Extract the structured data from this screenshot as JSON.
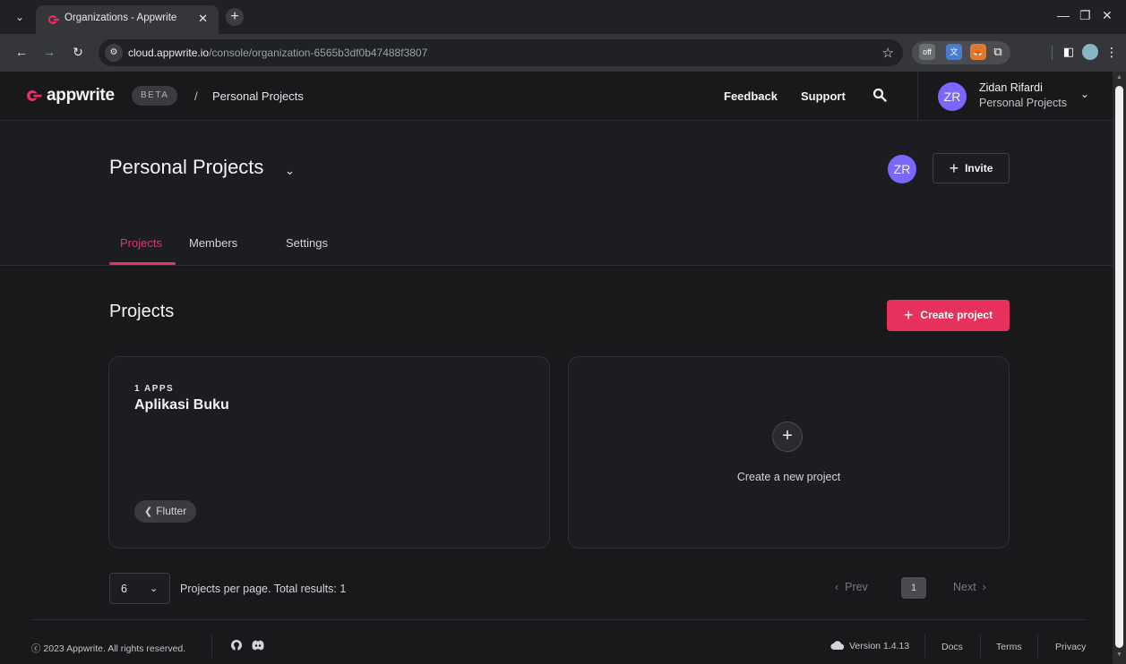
{
  "browser": {
    "tab_title": "Organizations - Appwrite",
    "url_host": "cloud.appwrite.io",
    "url_path": "/console/organization-6565b3df0b47488f3807"
  },
  "header": {
    "logo_text": "appwrite",
    "beta_label": "BETA",
    "breadcrumb_sep": "/",
    "breadcrumb": "Personal Projects",
    "feedback_label": "Feedback",
    "support_label": "Support",
    "user_initials": "ZR",
    "user_name": "Zidan Rifardi",
    "user_org": "Personal Projects"
  },
  "org": {
    "title": "Personal Projects",
    "member_initials": "ZR",
    "invite_label": "Invite",
    "tabs": [
      {
        "label": "Projects",
        "active": true
      },
      {
        "label": "Members",
        "active": false
      },
      {
        "label": "Settings",
        "active": false
      }
    ]
  },
  "projects": {
    "title": "Projects",
    "create_label": "Create project",
    "cards": [
      {
        "apps": "1 APPS",
        "name": "Aplikasi Buku",
        "platform": "Flutter"
      }
    ],
    "new_project_label": "Create a new project"
  },
  "pagination": {
    "per_page": "6",
    "summary": "Projects per page. Total results: 1",
    "prev_label": "Prev",
    "current_page": "1",
    "next_label": "Next"
  },
  "footer": {
    "copyright": "ⓒ 2023 Appwrite. All rights reserved.",
    "version": "Version 1.4.13",
    "docs_label": "Docs",
    "terms_label": "Terms",
    "privacy_label": "Privacy"
  },
  "colors": {
    "accent": "#f02e65",
    "button_primary": "#e6315c",
    "avatar": "#7c67fe",
    "background": "#19191c"
  }
}
